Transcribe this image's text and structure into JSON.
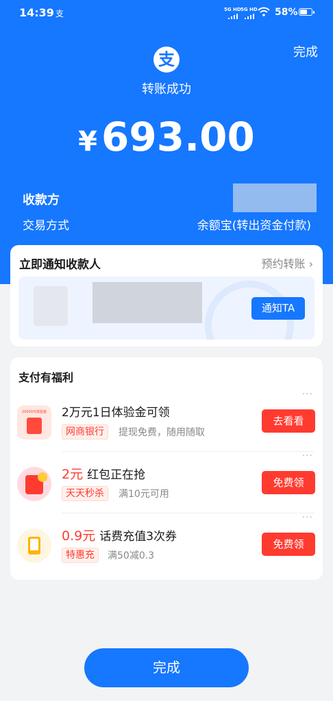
{
  "status_bar": {
    "time": "14:39",
    "app_glyph": "支",
    "net1": "5G HD",
    "net2": "5G HD",
    "battery": "58%"
  },
  "header": {
    "done_label": "完成",
    "logo_glyph": "支",
    "status": "转账成功",
    "currency": "¥",
    "amount": "693.00"
  },
  "details": {
    "payee_label": "收款方",
    "method_label": "交易方式",
    "method_value": "余额宝(转出资金付款)"
  },
  "notify": {
    "title": "立即通知收款人",
    "appointment_link": "预约转账",
    "button": "通知TA"
  },
  "welfare": {
    "title": "支付有福利",
    "items": [
      {
        "highlight": "",
        "title": "2万元1日体验金可领",
        "tag": "网商银行",
        "desc": "提现免费，随用随取",
        "button": "去看看",
        "thumb_text": "20000元体验金"
      },
      {
        "highlight": "2元",
        "title": "红包正在抢",
        "tag": "天天秒杀",
        "desc": "满10元可用",
        "button": "免费领"
      },
      {
        "highlight": "0.9元",
        "title": "话费充值3次券",
        "tag": "特惠充",
        "desc": "满50减0.3",
        "button": "免费领"
      }
    ]
  },
  "footer": {
    "done_button": "完成"
  },
  "colors": {
    "brand_blue": "#1677ff",
    "promo_red": "#ff3b30"
  }
}
